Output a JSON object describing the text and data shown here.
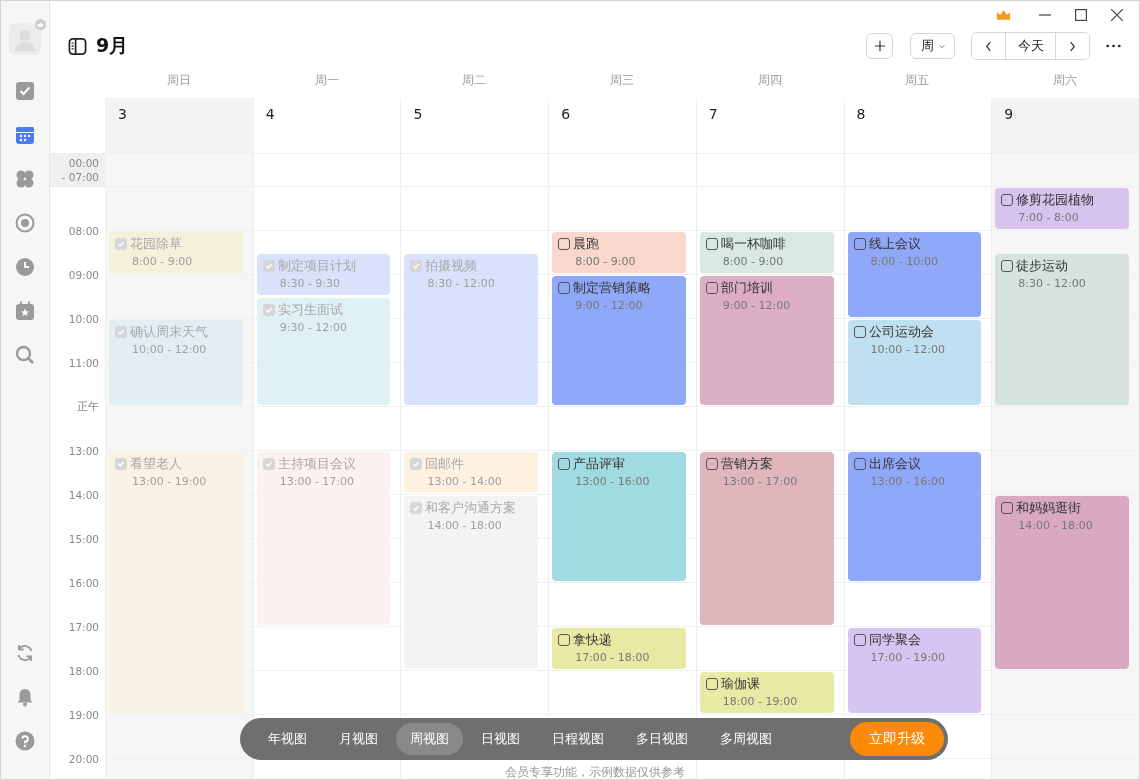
{
  "sidebar": {
    "items": [
      {
        "selected": false
      },
      {
        "selected": true
      },
      {
        "selected": false
      },
      {
        "selected": false
      },
      {
        "selected": false
      },
      {
        "selected": false
      },
      {
        "selected": false
      }
    ],
    "bottom_items": [
      {
        "selected": false
      },
      {
        "selected": false
      },
      {
        "selected": false
      }
    ]
  },
  "header": {
    "title": "9月",
    "view_dropdown": "周",
    "today_button": "今天"
  },
  "days": [
    {
      "weekday": "周日",
      "date": "3",
      "weekend": true,
      "events": [
        {
          "title": "花园除草",
          "time": "8:00 - 9:00",
          "done": true,
          "color": "#f2f1da"
        },
        {
          "title": "确认周末天气",
          "time": "10:00 - 12:00",
          "done": true,
          "color": "#e2eef3"
        },
        {
          "title": "看望老人",
          "time": "13:00 - 19:00",
          "done": true,
          "color": "#faf0e4"
        }
      ]
    },
    {
      "weekday": "周一",
      "date": "4",
      "weekend": false,
      "events": [
        {
          "title": "制定项目计划",
          "time": "8:30 - 9:30",
          "done": true,
          "color": "#d9e1fb"
        },
        {
          "title": "实习生面试",
          "time": "9:30 - 12:00",
          "done": true,
          "color": "#dff1f5"
        },
        {
          "title": "主持项目会议",
          "time": "13:00 - 17:00",
          "done": true,
          "color": "#fdf1ef"
        }
      ]
    },
    {
      "weekday": "周二",
      "date": "5",
      "weekend": false,
      "events": [
        {
          "title": "拍摄视频",
          "time": "8:30 - 12:00",
          "done": true,
          "color": "#d9e1fb"
        },
        {
          "title": "回邮件",
          "time": "13:00 - 14:00",
          "done": true,
          "color": "#fdf1e2"
        },
        {
          "title": "和客户沟通方案",
          "time": "14:00 - 18:00",
          "done": true,
          "color": "#f1f4f2"
        }
      ]
    },
    {
      "weekday": "周三",
      "date": "6",
      "weekend": false,
      "events": [
        {
          "title": "晨跑",
          "time": "8:00 - 9:00",
          "done": false,
          "color": "#f9d7cd"
        },
        {
          "title": "制定营销策略",
          "time": "9:00 - 12:00",
          "done": false,
          "color": "#8fa8f8"
        },
        {
          "title": "产品评审",
          "time": "13:00 - 16:00",
          "done": false,
          "color": "#a1dbe2"
        },
        {
          "title": "拿快递",
          "time": "17:00 - 18:00",
          "done": false,
          "color": "#e9e9a6"
        }
      ]
    },
    {
      "weekday": "周四",
      "date": "7",
      "weekend": false,
      "events": [
        {
          "title": "喝一杯咖啡",
          "time": "8:00 - 9:00",
          "done": false,
          "color": "#d7e9e0"
        },
        {
          "title": "部门培训",
          "time": "9:00 - 12:00",
          "done": false,
          "color": "#dbaec3"
        },
        {
          "title": "营销方案",
          "time": "13:00 - 17:00",
          "done": false,
          "color": "#dfb6bb"
        },
        {
          "title": "瑜伽课",
          "time": "18:00 - 19:00",
          "done": false,
          "color": "#e9e9a6"
        }
      ]
    },
    {
      "weekday": "周五",
      "date": "8",
      "weekend": false,
      "events": [
        {
          "title": "线上会议",
          "time": "8:00 - 10:00",
          "done": false,
          "color": "#8fa8f8"
        },
        {
          "title": "公司运动会",
          "time": "10:00 - 12:00",
          "done": false,
          "color": "#bfe0f0"
        },
        {
          "title": "出席会议",
          "time": "13:00 - 16:00",
          "done": false,
          "color": "#8fa8f8"
        },
        {
          "title": "同学聚会",
          "time": "17:00 - 19:00",
          "done": false,
          "color": "#d8c4f0"
        }
      ]
    },
    {
      "weekday": "周六",
      "date": "9",
      "weekend": true,
      "events": [
        {
          "title": "修剪花园植物",
          "time": "7:00 - 8:00",
          "done": false,
          "color": "#d6c3ee"
        },
        {
          "title": "徒步运动",
          "time": "8:30 - 12:00",
          "done": false,
          "color": "#d5e3dc"
        },
        {
          "title": "和妈妈逛街",
          "time": "14:00 - 18:00",
          "done": false,
          "color": "#d8a9bf"
        }
      ]
    }
  ],
  "time_gutter": {
    "collapsed_range": [
      "00:00",
      "- 07:00"
    ],
    "hours": [
      "08:00",
      "09:00",
      "10:00",
      "11:00",
      "正午",
      "13:00",
      "14:00",
      "15:00",
      "16:00",
      "17:00",
      "18:00",
      "19:00",
      "20:00"
    ]
  },
  "view_bar": {
    "views": [
      {
        "label": "年视图",
        "selected": false
      },
      {
        "label": "月视图",
        "selected": false
      },
      {
        "label": "周视图",
        "selected": true
      },
      {
        "label": "日视图",
        "selected": false
      },
      {
        "label": "日程视图",
        "selected": false
      },
      {
        "label": "多日视图",
        "selected": false
      },
      {
        "label": "多周视图",
        "selected": false
      }
    ],
    "upgrade_button": "立即升级"
  },
  "footer_note": "会员专享功能，示例数据仅供参考"
}
